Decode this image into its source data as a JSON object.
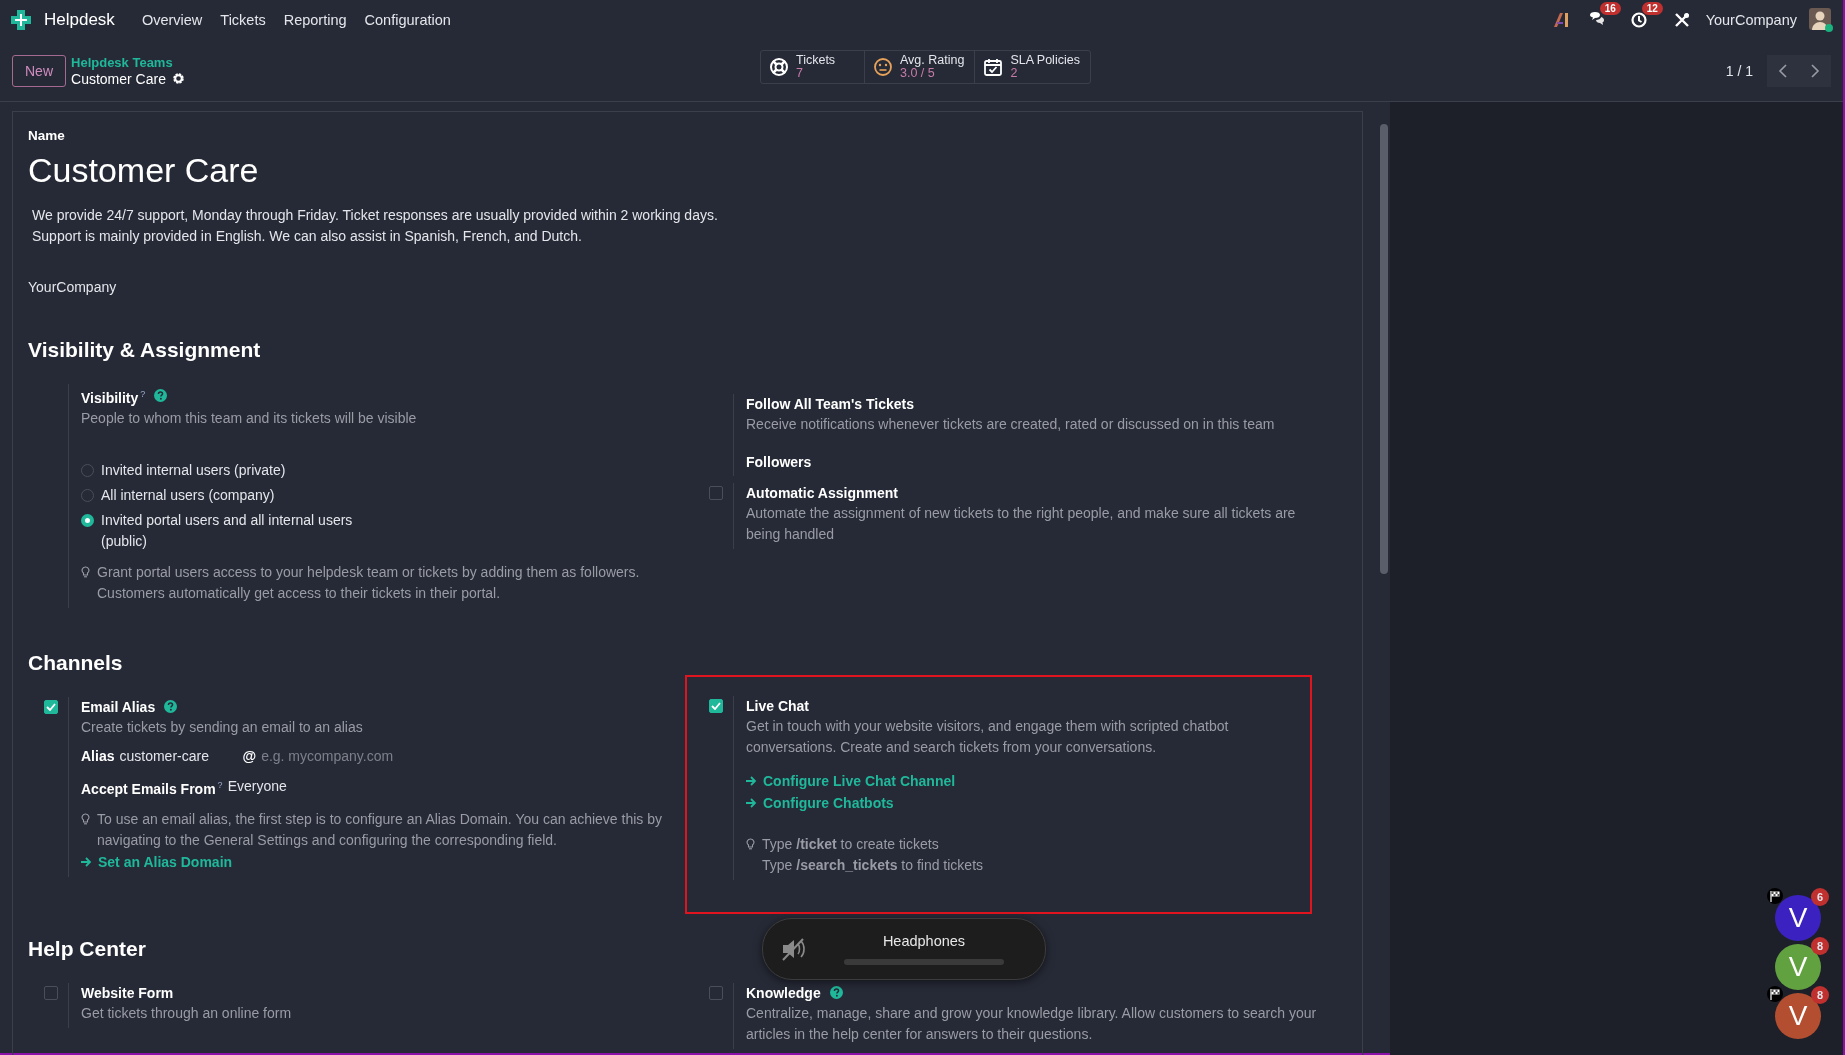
{
  "navbar": {
    "app": "Helpdesk",
    "menus": [
      "Overview",
      "Tickets",
      "Reporting",
      "Configuration"
    ],
    "badges": [
      {
        "count": "16"
      },
      {
        "count": "12"
      }
    ],
    "company": "YourCompany"
  },
  "control_panel": {
    "new_button": "New",
    "breadcrumb": "Helpdesk Teams",
    "record": "Customer Care",
    "stats": [
      {
        "label": "Tickets",
        "value": "7"
      },
      {
        "label": "Avg. Rating",
        "value": "3.0 / 5"
      },
      {
        "label": "SLA Policies",
        "value": "2"
      }
    ],
    "pager": "1 / 1"
  },
  "form": {
    "name_label": "Name",
    "name": "Customer Care",
    "description": [
      "We provide 24/7 support, Monday through Friday. Ticket responses are usually provided within 2 working days.",
      "Support is mainly provided in English. We can also assist in Spanish, French, and Dutch."
    ],
    "company": "YourCompany",
    "sections": [
      {
        "title": "Visibility & Assignment",
        "columns": [
          [
            {
              "kind": "plain",
              "title": "Visibility$^{?}$",
              "help": true,
              "description": [
                "People to whom this team and its tickets will be visible"
              ],
              "body": [
                {
                  "kind": "radios",
                  "options": [
                    {
                      "label": "Invited internal users (private)",
                      "selected": false
                    },
                    {
                      "label": "All internal users (company)",
                      "selected": false
                    },
                    {
                      "label": "Invited portal users and all internal users (public)",
                      "selected": true
                    }
                  ]
                },
                {
                  "kind": "hint",
                  "lines": [
                    "Grant portal users access to your helpdesk team or tickets by adding them as followers.",
                    "Customers automatically get access to their tickets in their portal."
                  ]
                }
              ]
            }
          ],
          [
            {
              "kind": "plain",
              "title": "Follow All Team's Tickets",
              "description": [
                "Receive notifications whenever tickets are created, rated or discussed on in this team"
              ],
              "body": [
                {
                  "kind": "label",
                  "text": "Followers"
                }
              ]
            },
            {
              "kind": "toggle",
              "checked": false,
              "title": "Automatic Assignment",
              "description": [
                "Automate the assignment of new tickets to the right people, and make sure all tickets are",
                "being handled"
              ]
            }
          ]
        ]
      },
      {
        "title": "Channels",
        "columns": [
          [
            {
              "kind": "toggle",
              "checked": true,
              "title": "Email Alias",
              "help": true,
              "description": [
                "Create tickets by sending an email to an alias"
              ],
              "body": [
                {
                  "kind": "field",
                  "label": "Alias",
                  "value": "customer-care",
                  "suffix": "@",
                  "placeholder": "e.g. mycompany.com"
                },
                {
                  "kind": "field",
                  "label": "Accept Emails From$^{?}$",
                  "value": "Everyone"
                },
                {
                  "kind": "hint",
                  "lines": [
                    "To use an email alias, the first step is to configure an Alias Domain. You can achieve this by",
                    "navigating to the General Settings and configuring the corresponding field."
                  ]
                },
                {
                  "kind": "link",
                  "label": "Set an Alias Domain"
                }
              ]
            }
          ],
          [
            {
              "kind": "toggle",
              "checked": true,
              "highlighted": true,
              "title": "Live Chat",
              "description": [
                "Get in touch with your website visitors, and engage them with scripted chatbot",
                "conversations. Create and search tickets from your conversations."
              ],
              "body": [
                {
                  "kind": "link",
                  "label": "Configure Live Chat Channel"
                },
                {
                  "kind": "link",
                  "label": "Configure Chatbots"
                },
                {
                  "kind": "hint",
                  "lines": [
                    "Type **/ticket** to create tickets",
                    "Type **/search_tickets** to find tickets"
                  ]
                }
              ]
            }
          ]
        ]
      },
      {
        "title": "Help Center",
        "columns": [
          [
            {
              "kind": "toggle",
              "checked": false,
              "title": "Website Form",
              "description": [
                "Get tickets through an online form"
              ]
            }
          ],
          [
            {
              "kind": "toggle",
              "checked": false,
              "title": "Knowledge",
              "help": true,
              "description": [
                "Centralize, manage, share and grow your knowledge library. Allow customers to search your",
                "articles in the help center for answers to their questions."
              ]
            }
          ]
        ]
      }
    ]
  },
  "osd": {
    "device": "Headphones",
    "muted": true
  },
  "chat_bubbles": [
    {
      "initial": "V",
      "count": "6",
      "color": "#3b22c0",
      "flag": true
    },
    {
      "initial": "V",
      "count": "8",
      "color": "#62a140",
      "flag": false
    },
    {
      "initial": "V",
      "count": "8",
      "color": "#b44e30",
      "flag": true
    }
  ]
}
